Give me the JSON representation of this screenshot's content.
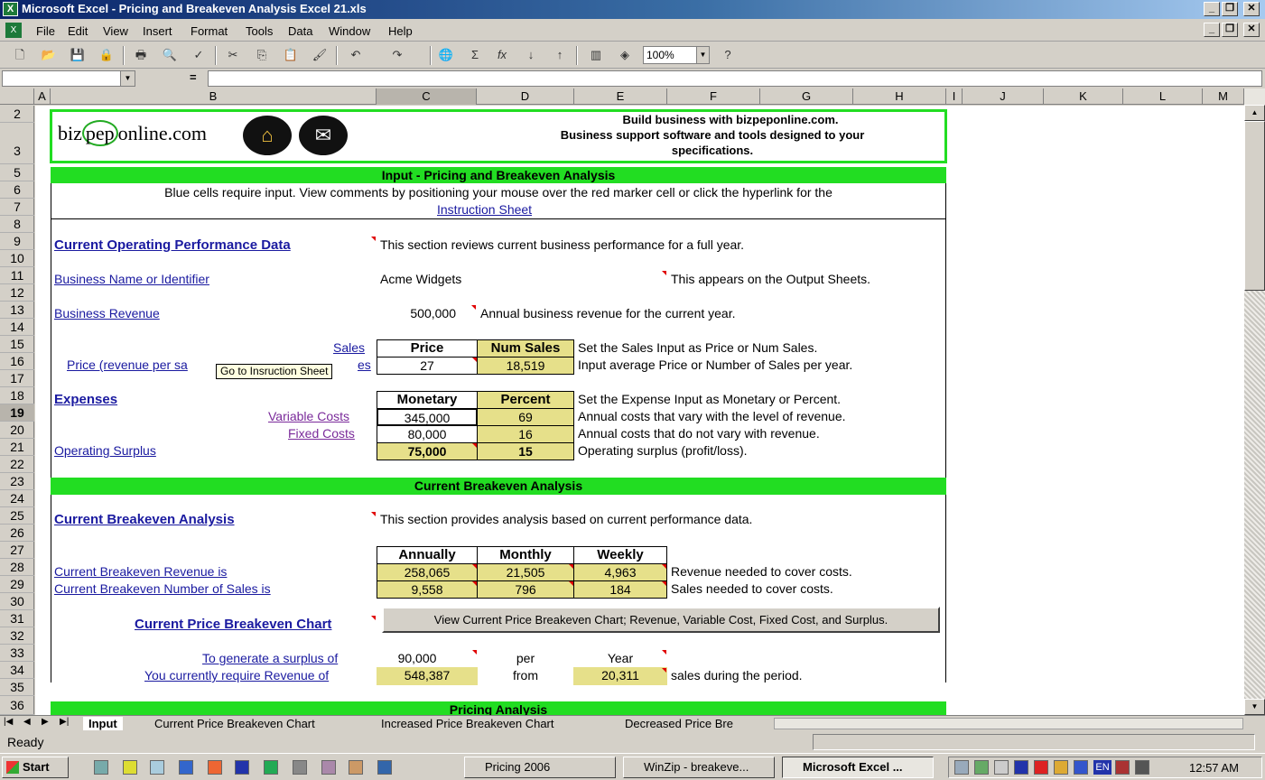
{
  "window": {
    "title": "Microsoft Excel - Pricing and Breakeven Analysis Excel 21.xls"
  },
  "menu": [
    "File",
    "Edit",
    "View",
    "Insert",
    "Format",
    "Tools",
    "Data",
    "Window",
    "Help"
  ],
  "toolbar": {
    "zoom": "100%"
  },
  "formula": {
    "equals": "="
  },
  "columns": [
    "A",
    "B",
    "C",
    "D",
    "E",
    "F",
    "G",
    "H",
    "I",
    "J",
    "K",
    "L",
    "M"
  ],
  "rows": [
    "2",
    "3",
    "5",
    "6",
    "7",
    "8",
    "9",
    "10",
    "11",
    "12",
    "13",
    "14",
    "15",
    "16",
    "17",
    "18",
    "19",
    "20",
    "21",
    "22",
    "23",
    "24",
    "25",
    "26",
    "27",
    "28",
    "29",
    "30",
    "31",
    "32",
    "33",
    "34",
    "35",
    "36"
  ],
  "banner": {
    "logo_pre": "biz",
    "logo_mid": "pep",
    "logo_post": "online.com",
    "line1": "Build business with bizpeponline.com.",
    "line2": "Business support software and tools designed to your",
    "line3": "specifications."
  },
  "input_header": "Input - Pricing and Breakeven Analysis",
  "intro": {
    "line1": "Blue cells require input. View comments by positioning your mouse over the red marker cell or click the hyperlink for the",
    "link": "Instruction Sheet"
  },
  "current": {
    "title": "Current Operating Performance Data",
    "desc": "This section reviews current business performance for a full year."
  },
  "business": {
    "label": "Business Name or Identifier",
    "value": "Acme Widgets",
    "note": "This appears on the Output Sheets."
  },
  "revenue": {
    "label": "Business Revenue",
    "value": "500,000",
    "note": "Annual business revenue for the current year."
  },
  "sales": {
    "label": "Sales",
    "price_hdr": "Price",
    "num_hdr": "Num Sales",
    "note": "Set the Sales Input as Price or Num Sales.",
    "row_label": "Price (revenue per sa",
    "row_label_tail": "es",
    "price": "27",
    "num": "18,519",
    "row_note": "Input average Price or Number of Sales per year.",
    "tooltip": "Go to Insruction Sheet"
  },
  "expenses": {
    "label": "Expenses",
    "mon_hdr": "Monetary",
    "pct_hdr": "Percent",
    "note": "Set the Expense Input as Monetary or Percent.",
    "variable": {
      "label": "Variable Costs",
      "mon": "345,000",
      "pct": "69",
      "note": "Annual costs that vary with the level of revenue."
    },
    "fixed": {
      "label": "Fixed Costs",
      "mon": "80,000",
      "pct": "16",
      "note": "Annual costs that do not vary with revenue."
    },
    "surplus": {
      "label": "Operating Surplus",
      "mon": "75,000",
      "pct": "15",
      "note": "Operating surplus (profit/loss)."
    }
  },
  "breakeven_header": "Current Breakeven Analysis",
  "breakeven": {
    "title": "Current Breakeven Analysis",
    "desc": "This section provides analysis based on current performance data.",
    "hdr_annual": "Annually",
    "hdr_monthly": "Monthly",
    "hdr_weekly": "Weekly",
    "rev": {
      "label": "Current Breakeven Revenue is",
      "a": "258,065",
      "m": "21,505",
      "w": "4,963",
      "note": "Revenue needed to cover costs."
    },
    "num": {
      "label": "Current Breakeven Number of Sales is",
      "a": "9,558",
      "m": "796",
      "w": "184",
      "note": "Sales needed to cover costs."
    }
  },
  "chart": {
    "label": "Current Price Breakeven Chart",
    "button": "View Current Price Breakeven Chart; Revenue, Variable Cost, Fixed Cost, and Surplus."
  },
  "surplus_gen": {
    "label": "To generate a surplus of",
    "value": "90,000",
    "per": "per",
    "period": "Year",
    "req_label": "You currently require Revenue of",
    "req_value": "548,387",
    "from": "from",
    "sales": "20,311",
    "note": "sales during the period."
  },
  "pricing_header": "Pricing Analysis",
  "tabs": [
    "Input",
    "Current Price Breakeven Chart",
    "Increased Price Breakeven Chart",
    "Decreased Price Bre"
  ],
  "status": "Ready",
  "taskbar": {
    "start": "Start",
    "items": [
      "Pricing 2006",
      "WinZip - breakeve...",
      "Microsoft Excel ..."
    ],
    "time": "12:57 AM",
    "lang": "EN"
  }
}
